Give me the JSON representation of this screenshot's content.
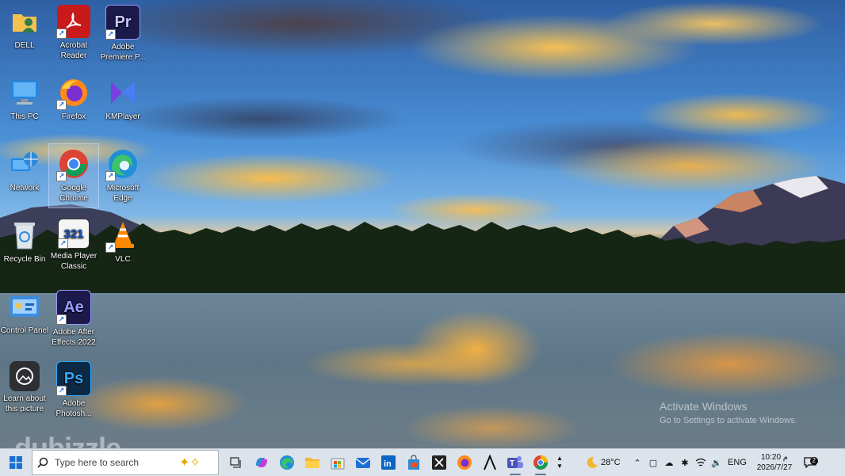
{
  "desktop": {
    "icons": [
      {
        "id": "dell",
        "label": "DELL"
      },
      {
        "id": "acrobat",
        "label": "Acrobat Reader"
      },
      {
        "id": "premiere",
        "label": "Adobe Premiere P..."
      },
      {
        "id": "thispc",
        "label": "This PC"
      },
      {
        "id": "firefox",
        "label": "Firefox"
      },
      {
        "id": "kmplayer",
        "label": "KMPlayer"
      },
      {
        "id": "network",
        "label": "Network"
      },
      {
        "id": "chrome",
        "label": "Google Chrome"
      },
      {
        "id": "edge",
        "label": "Microsoft Edge"
      },
      {
        "id": "recycle",
        "label": "Recycle Bin"
      },
      {
        "id": "mpc",
        "label": "Media Player Classic"
      },
      {
        "id": "vlc",
        "label": "VLC"
      },
      {
        "id": "controlpanel",
        "label": "Control Panel"
      },
      {
        "id": "aftereffects",
        "label": "Adobe After Effects 2022"
      },
      {
        "id": "learn",
        "label": "Learn about this picture"
      },
      {
        "id": "photoshop",
        "label": "Adobe Photosh..."
      }
    ],
    "icon_glyphs": {
      "premiere": "Pr",
      "aftereffects": "Ae",
      "photoshop": "Ps",
      "mpc": "321"
    }
  },
  "watermark": {
    "activate_title": "Activate Windows",
    "activate_sub": "Go to Settings to activate Windows.",
    "brand": "dubizzle"
  },
  "taskbar": {
    "search_placeholder": "Type here to search",
    "apps": [
      "task-view",
      "copilot",
      "edge",
      "file-explorer",
      "store",
      "mail",
      "linkedin",
      "shopping",
      "x",
      "firefox",
      "inkscape",
      "teams",
      "chrome"
    ],
    "weather": "28°C",
    "language": "ENG",
    "time": "10:20 م",
    "date": "2026/7/27",
    "notification_count": "2"
  },
  "colors": {
    "taskbar_bg": "#dce3ea",
    "windows_blue": "#1a6fd3",
    "adobe_dark": "#1b1a4a",
    "acrobat_red": "#c81a1a"
  }
}
